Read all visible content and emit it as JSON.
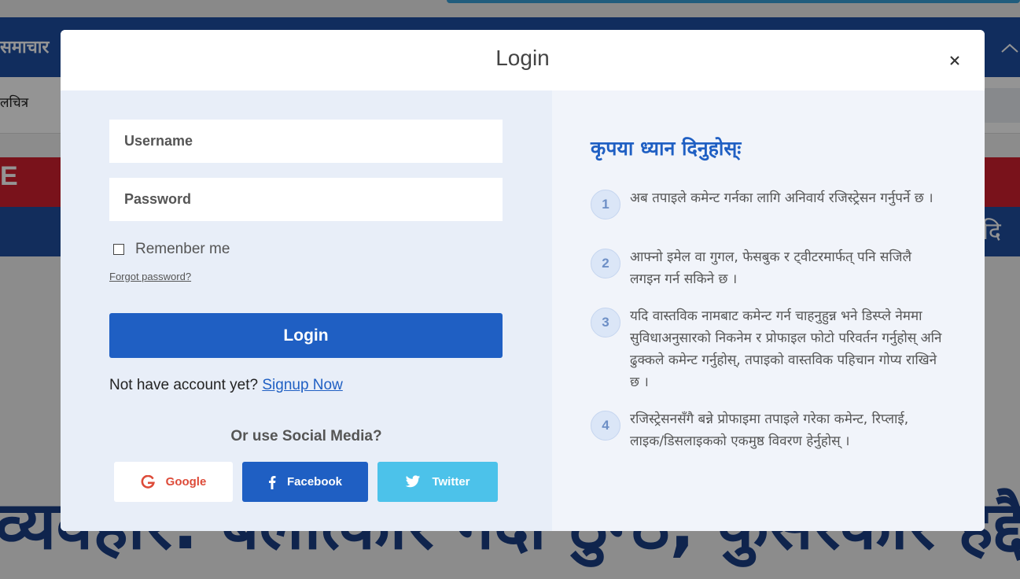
{
  "background": {
    "logo_text": "समाचार",
    "nav_item": "लचित्र",
    "red_banner_letter": "E",
    "blue_banner_text": ", दि",
    "headline": "व्यवहार: बलात्कार गर्दा ठुन्ठ, कुसरकार हद्दै"
  },
  "modal": {
    "title": "Login",
    "close_icon": "close-icon",
    "form": {
      "username_placeholder": "Username",
      "password_placeholder": "Password",
      "remember_label": "Remenber me",
      "forgot_label": "Forgot password?",
      "login_label": "Login",
      "signup_prompt": "Not have account yet?",
      "signup_link": "Signup Now"
    },
    "social": {
      "title": "Or use Social Media?",
      "google": "Google",
      "facebook": "Facebook",
      "twitter": "Twitter"
    },
    "notice": {
      "title": "कृपया ध्यान दिनुहोस्ः",
      "items": [
        {
          "num": "1",
          "text": "अब तपाइले कमेन्ट गर्नका लागि अनिवार्य रजिस्ट्रेसन गर्नुपर्ने छ ।"
        },
        {
          "num": "2",
          "text": "आफ्नो इमेल वा गुगल, फेसबुक र ट्वीटरमार्फत् पनि सजिलै लगइन गर्न सकिने छ ।"
        },
        {
          "num": "3",
          "text": "यदि वास्तविक नामबाट कमेन्ट गर्न चाहनुहुन्न भने डिस्प्ले नेममा सुविधाअनुसारको निकनेम र प्रोफाइल फोटो परिवर्तन गर्नुहोस् अनि ढुक्कले कमेन्ट गर्नुहोस्, तपाइको वास्तविक पहिचान गोप्य राखिने छ ।"
        },
        {
          "num": "4",
          "text": "रजिस्ट्रेसनसँगै बन्ने प्रोफाइमा तपाइले गरेका कमेन्ट, रिप्लाई, लाइक/डिसलाइकको एकमुष्ठ विवरण हेर्नुहोस् ।"
        }
      ]
    }
  },
  "colors": {
    "primary": "#1f5fc3",
    "google": "#dd4b39",
    "twitter": "#4cc2ea",
    "left_pane_bg": "#e8eef8",
    "right_pane_bg": "#f1f4fa"
  }
}
